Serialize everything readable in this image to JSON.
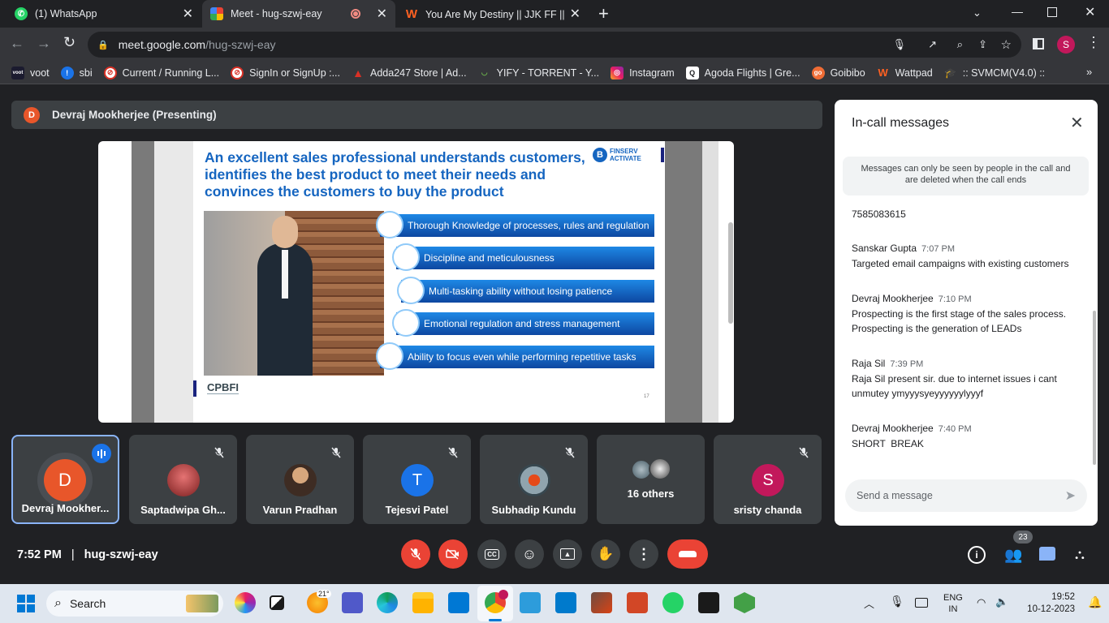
{
  "tabs": [
    {
      "title": "(1) WhatsApp",
      "icon": "whatsapp-icon"
    },
    {
      "title": "Meet - hug-szwj-eay",
      "icon": "meet-icon"
    },
    {
      "title": "You Are My Destiny || JJK FF || ✓",
      "icon": "wattpad-icon"
    }
  ],
  "address": {
    "url_host": "meet.google.com",
    "url_path": "/hug-szwj-eay"
  },
  "profile_initial": "S",
  "bookmarks": [
    {
      "label": "voot",
      "icon": "voot-icon"
    },
    {
      "label": "sbi",
      "icon": "sbi-icon"
    },
    {
      "label": "Current / Running L...",
      "icon": "blocked-icon"
    },
    {
      "label": "SignIn or SignUp :...",
      "icon": "blocked-icon"
    },
    {
      "label": "Adda247 Store | Ad...",
      "icon": "adda-icon"
    },
    {
      "label": "YIFY - TORRENT - Y...",
      "icon": "yify-icon"
    },
    {
      "label": "Instagram",
      "icon": "instagram-icon"
    },
    {
      "label": "Agoda Flights | Gre...",
      "icon": "agoda-icon"
    },
    {
      "label": "Goibibo",
      "icon": "goibibo-icon"
    },
    {
      "label": "Wattpad",
      "icon": "wattpad-icon"
    },
    {
      "label": ":: SVMCM(V4.0) ::",
      "icon": "svmcm-icon"
    }
  ],
  "presenter": {
    "initial": "D",
    "label": "Devraj Mookherjee (Presenting)"
  },
  "slide": {
    "title_lines": [
      "An excellent sales professional understands customers,",
      "identifies the best product to meet their needs and",
      "convinces the customers to buy the product"
    ],
    "brand_lines": [
      "FINSERV",
      "ACTIVATE"
    ],
    "items": [
      "Thorough Knowledge of processes, rules and regulation",
      "Discipline and meticulousness",
      "Multi-tasking ability without losing patience",
      "Emotional regulation and stress management",
      "Ability to focus even while performing repetitive tasks"
    ],
    "footer_logo": "CPBFI",
    "page_number": "17"
  },
  "participants": [
    {
      "name": "Devraj Mookher...",
      "initial": "D",
      "color": "#e8562a",
      "speaking": true
    },
    {
      "name": "Saptadwipa Gh...",
      "initial": "",
      "color": "#8a3a2a",
      "speaking": false
    },
    {
      "name": "Varun Pradhan",
      "initial": "",
      "color": "#5a4a3a",
      "speaking": false
    },
    {
      "name": "Tejesvi Patel",
      "initial": "T",
      "color": "#1a73e8",
      "speaking": false
    },
    {
      "name": "Subhadip Kundu",
      "initial": "",
      "color": "#4a6a8a",
      "speaking": false
    },
    {
      "name": "16 others",
      "initial": "",
      "color": "#777777",
      "speaking": false
    },
    {
      "name": "sristy chanda",
      "initial": "S",
      "color": "#c2185b",
      "speaking": false
    }
  ],
  "chat": {
    "title": "In-call messages",
    "notice": "Messages can only be seen by people in the call and are deleted when the call ends",
    "messages": [
      {
        "sender": "",
        "time": "",
        "lines": [
          "7585083615"
        ]
      },
      {
        "sender": "Sanskar Gupta",
        "time": "7:07 PM",
        "lines": [
          "Targeted email campaigns with existing customers"
        ]
      },
      {
        "sender": "Devraj Mookherjee",
        "time": "7:10 PM",
        "lines": [
          "Prospecting is the first stage of the sales process.",
          "Prospecting is the generation of LEADs"
        ]
      },
      {
        "sender": "Raja Sil",
        "time": "7:39 PM",
        "lines": [
          "Raja Sil present sir. due to internet issues i cant",
          "unmutey ymyyysyeyyyyyylyyyf"
        ]
      },
      {
        "sender": "Devraj Mookherjee",
        "time": "7:40 PM",
        "lines": [
          "SHORT  BREAK"
        ]
      }
    ],
    "input_placeholder": "Send a message"
  },
  "meeting": {
    "time": "7:52 PM",
    "separator": "|",
    "code": "hug-szwj-eay",
    "people_count": "23"
  },
  "taskbar": {
    "search_placeholder": "Search",
    "weather": "21°",
    "lang_top": "ENG",
    "lang_bottom": "IN",
    "clock_time": "19:52",
    "clock_date": "10-12-2023"
  }
}
